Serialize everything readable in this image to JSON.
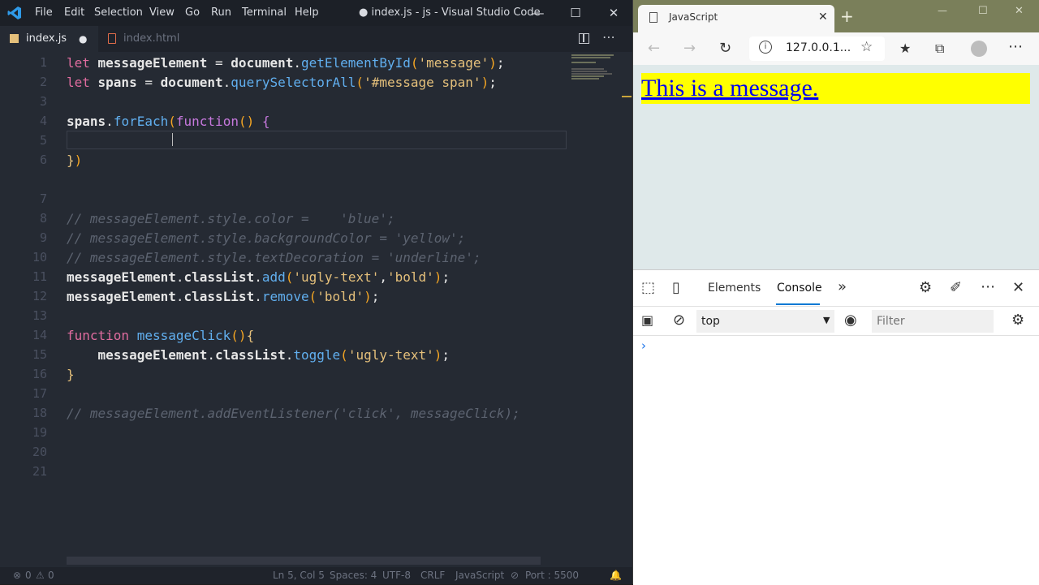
{
  "vscode": {
    "menu": [
      "File",
      "Edit",
      "Selection",
      "View",
      "Go",
      "Run",
      "Terminal",
      "Help"
    ],
    "window_title": "● index.js - js - Visual Studio Code",
    "tabs": [
      {
        "label": "index.js",
        "icon": "js-file-icon",
        "modified_dot": "●"
      },
      {
        "label": "index.html",
        "icon": "html-file-icon"
      }
    ],
    "line_numbers": [
      "1",
      "2",
      "3",
      "4",
      "5",
      "6",
      "7",
      "8",
      "9",
      "10",
      "11",
      "12",
      "13",
      "14",
      "15",
      "16",
      "17",
      "18",
      "19",
      "20",
      "21"
    ],
    "status": {
      "errors": "0",
      "warnings": "0",
      "position": "Ln 5, Col 5",
      "spaces": "Spaces: 4",
      "encoding": "UTF-8",
      "eol": "CRLF",
      "language": "JavaScript",
      "port": "Port : 5500"
    }
  },
  "browser": {
    "tab_title": "JavaScript",
    "address": "127.0.0.1...",
    "page_message": "This is a message.",
    "devtools": {
      "tabs": [
        "Elements",
        "Console"
      ],
      "active_tab": "Console",
      "context": "top",
      "filter_placeholder": "Filter",
      "prompt": "›"
    }
  },
  "colors": {
    "editor_bg": "#252a33",
    "message_bg": "#ffff00",
    "link": "#0000ee",
    "active_tab_underline": "#0078d4"
  }
}
